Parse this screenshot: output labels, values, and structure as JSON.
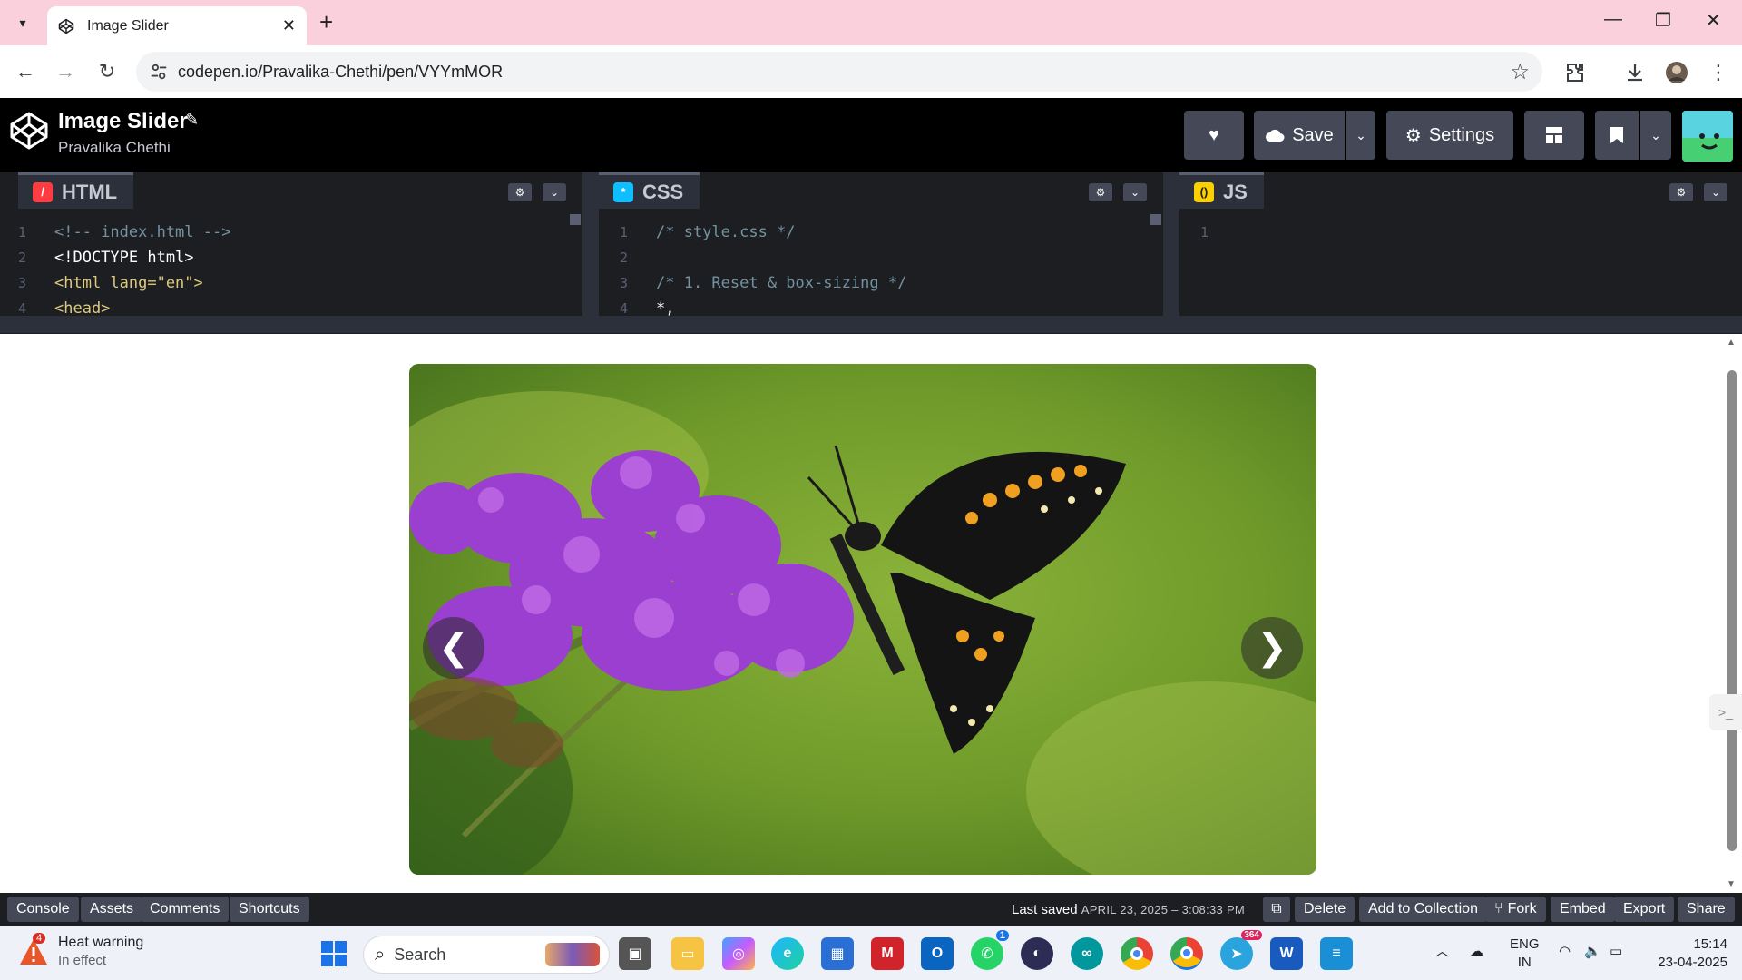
{
  "browser": {
    "tab_title": "Image Slider",
    "url": "codepen.io/Pravalika-Chethi/pen/VYYmMOR"
  },
  "pen": {
    "title": "Image Slider",
    "author": "Pravalika Chethi",
    "buttons": {
      "save": "Save",
      "settings": "Settings"
    }
  },
  "editors": [
    {
      "lang": "HTML",
      "lines": [
        {
          "n": "1",
          "text": "<!-- index.html -->"
        },
        {
          "n": "2",
          "text": "<!DOCTYPE html>"
        },
        {
          "n": "3",
          "text": "<html lang=\"en\">"
        },
        {
          "n": "4",
          "text": "<head>"
        }
      ]
    },
    {
      "lang": "CSS",
      "lines": [
        {
          "n": "1",
          "text": "/* style.css */"
        },
        {
          "n": "2",
          "text": ""
        },
        {
          "n": "3",
          "text": "/* 1. Reset & box-sizing */"
        },
        {
          "n": "4",
          "text": "*,"
        }
      ]
    },
    {
      "lang": "JS",
      "lines": [
        {
          "n": "1",
          "text": ""
        }
      ]
    }
  ],
  "preview": {
    "prev_arrow": "❮",
    "next_arrow": "❯"
  },
  "footer": {
    "left_buttons": [
      "Console",
      "Assets",
      "Comments",
      "Shortcuts"
    ],
    "last_saved_label": "Last saved",
    "last_saved_time": "APRIL 23, 2025 – 3:08:33 PM",
    "right_buttons": [
      "Delete",
      "Add to Collection",
      "Fork",
      "Embed",
      "Export",
      "Share"
    ]
  },
  "taskbar": {
    "weather_title": "Heat warning",
    "weather_sub": "In effect",
    "weather_badge": "4",
    "search_placeholder": "Search",
    "whatsapp_badge": "1",
    "telegram_badge": "364",
    "lang_line1": "ENG",
    "lang_line2": "IN",
    "time": "15:14",
    "date": "23-04-2025"
  },
  "colors": {
    "tabbar": "#f9d0dc",
    "codepen_dark": "#1d1e22",
    "button_gray": "#444857",
    "html_badge": "#ff3c41",
    "css_badge": "#0ebeff",
    "js_badge": "#fcd000"
  }
}
